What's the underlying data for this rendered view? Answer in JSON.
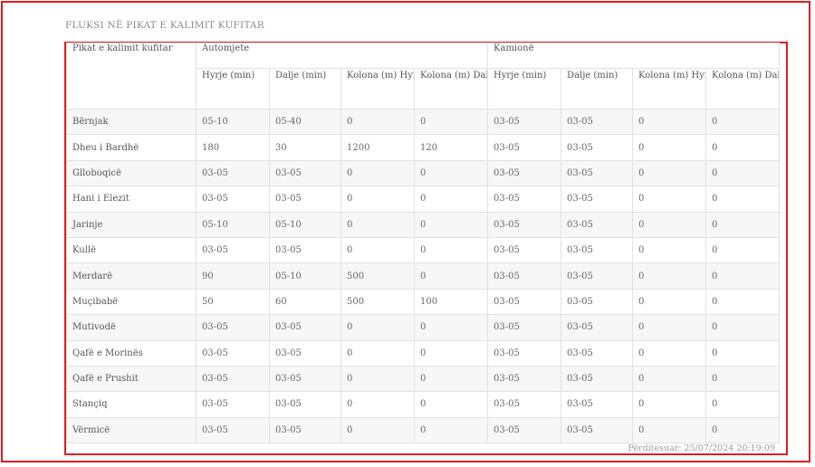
{
  "title": "FLUKSI NË PIKAT E KALIMIT KUFITAR",
  "header": {
    "crossing": "Pikat e kalimit kufitar",
    "cars": "Automjete",
    "trucks": "Kamionë",
    "sub": [
      "Hyrje (min)",
      "Dalje (min)",
      "Kolona (m) Hyrje",
      "Kolona (m) Dalje",
      "Hyrje (min)",
      "Dalje (min)",
      "Kolona (m) Hyrje",
      "Kolona (m) Dalje"
    ]
  },
  "rows": [
    {
      "name": "Bërnjak",
      "c": [
        "05-10",
        "05-40",
        "0",
        "0",
        "03-05",
        "03-05",
        "0",
        "0"
      ]
    },
    {
      "name": "Dheu i Bardhë",
      "c": [
        "180",
        "30",
        "1200",
        "120",
        "03-05",
        "03-05",
        "0",
        "0"
      ]
    },
    {
      "name": "Glloboqicë",
      "c": [
        "03-05",
        "03-05",
        "0",
        "0",
        "03-05",
        "03-05",
        "0",
        "0"
      ]
    },
    {
      "name": "Hani i Elezit",
      "c": [
        "03-05",
        "03-05",
        "0",
        "0",
        "03-05",
        "03-05",
        "0",
        "0"
      ]
    },
    {
      "name": "Jarinje",
      "c": [
        "05-10",
        "05-10",
        "0",
        "0",
        "03-05",
        "03-05",
        "0",
        "0"
      ]
    },
    {
      "name": "Kullë",
      "c": [
        "03-05",
        "03-05",
        "0",
        "0",
        "03-05",
        "03-05",
        "0",
        "0"
      ]
    },
    {
      "name": "Merdarë",
      "c": [
        "90",
        "05-10",
        "500",
        "0",
        "03-05",
        "03-05",
        "0",
        "0"
      ]
    },
    {
      "name": "Muçibabë",
      "c": [
        "50",
        "60",
        "500",
        "100",
        "03-05",
        "03-05",
        "0",
        "0"
      ]
    },
    {
      "name": "Mutivodë",
      "c": [
        "03-05",
        "03-05",
        "0",
        "0",
        "03-05",
        "03-05",
        "0",
        "0"
      ]
    },
    {
      "name": "Qafë e Morinës",
      "c": [
        "03-05",
        "03-05",
        "0",
        "0",
        "03-05",
        "03-05",
        "0",
        "0"
      ]
    },
    {
      "name": "Qafë e Prushit",
      "c": [
        "03-05",
        "03-05",
        "0",
        "0",
        "03-05",
        "03-05",
        "0",
        "0"
      ]
    },
    {
      "name": "Stançiq",
      "c": [
        "03-05",
        "03-05",
        "0",
        "0",
        "03-05",
        "03-05",
        "0",
        "0"
      ]
    },
    {
      "name": "Vërmicë",
      "c": [
        "03-05",
        "03-05",
        "0",
        "0",
        "03-05",
        "03-05",
        "0",
        "0"
      ]
    }
  ],
  "updated": "Përditesuar: 25/07/2024 20:19:09",
  "colors": {
    "frame": "#e11b22",
    "stripe": "#f7f7f7",
    "border": "#e2e2e2"
  }
}
